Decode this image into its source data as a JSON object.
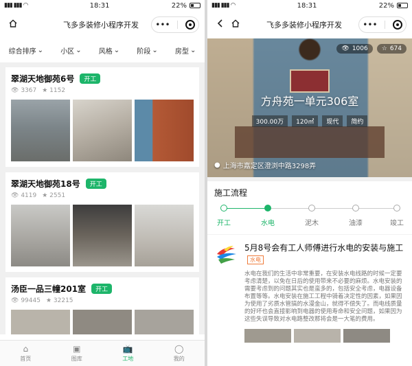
{
  "status": {
    "time": "18:31",
    "battery": "22%"
  },
  "app": {
    "title": "飞多多装修小程序开发"
  },
  "filters": [
    "综合排序",
    "小区",
    "风格",
    "阶段",
    "房型"
  ],
  "cards": [
    {
      "title": "翠湖天地御苑6号",
      "badge": "开工",
      "views": "3367",
      "stars": "1152"
    },
    {
      "title": "翠湖天地御苑18号",
      "badge": "开工",
      "views": "4119",
      "stars": "2551"
    },
    {
      "title": "汤臣一品三幢201室",
      "badge": "开工",
      "views": "99445",
      "stars": "32215"
    }
  ],
  "tabs": [
    "首页",
    "图库",
    "工地",
    "我的"
  ],
  "detail": {
    "views": "1006",
    "stars": "674",
    "title": "方舟苑一单元306室",
    "tags": [
      "300.00万",
      "120㎡",
      "现代",
      "简约"
    ],
    "location": "上海市嘉定区澄浏中路3298弄",
    "section_title": "施工流程",
    "steps": [
      "开工",
      "水电",
      "泥木",
      "油漆",
      "竣工"
    ],
    "article": {
      "title": "5月8号会有工人师傅进行水电的安装与施工",
      "tag": "水电",
      "text": "水电在我们的生活中非常重要，在安装水电线路的时候一定要考虑清楚，以免在日后的使用带来不必要的麻烦。水电安装的需要考虑到的问题其实也是蛮多的，包括安全考虑，电器设备布置等等。水电安装在施工工程中骑着决定性的因素，如果因为使用了劣质水管搞的水漫金山，就得不偿失了。而电线质量的好坏也会直接影响到电器的使用寿命和安全问题，如果因为这些失误导致对水电路整改那将会是一大笔的费用。"
    }
  }
}
